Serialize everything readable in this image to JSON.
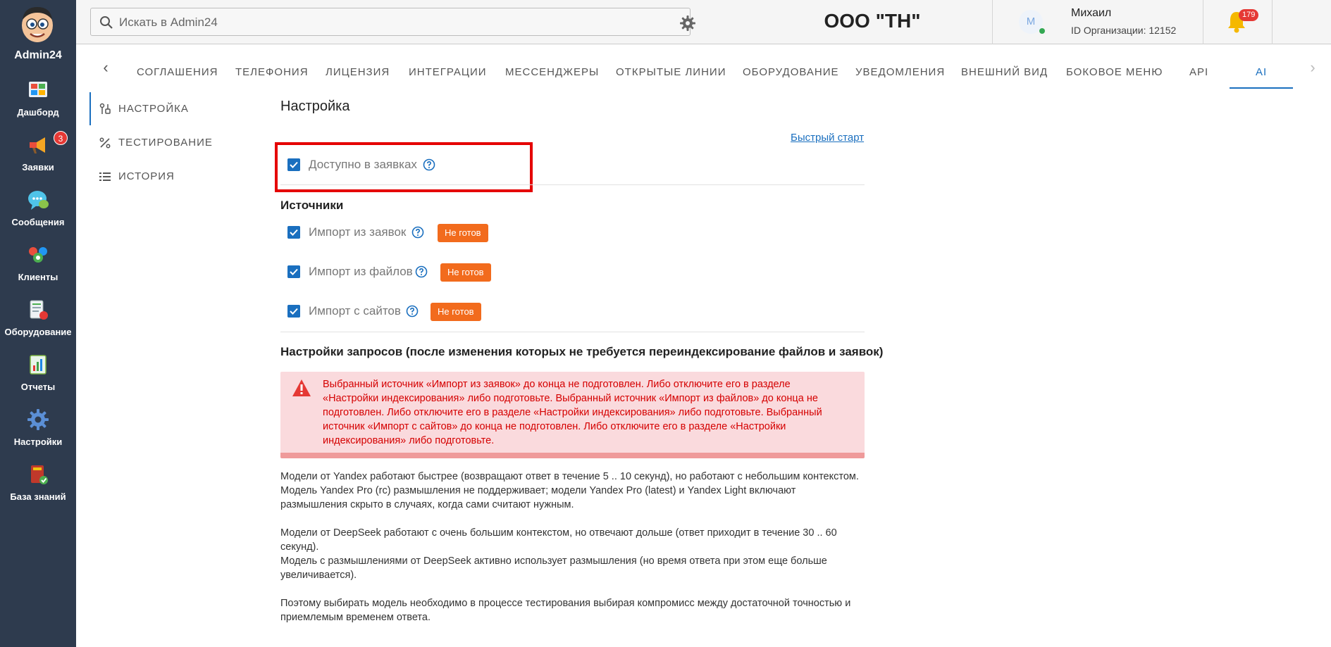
{
  "sidebar": {
    "brand": "Admin24",
    "items": [
      {
        "label": "Дашборд",
        "icon": "dashboard-icon"
      },
      {
        "label": "Заявки",
        "icon": "megaphone-icon",
        "badge": "3"
      },
      {
        "label": "Сообщения",
        "icon": "chat-icon"
      },
      {
        "label": "Клиенты",
        "icon": "clients-icon"
      },
      {
        "label": "Оборудование",
        "icon": "equipment-icon"
      },
      {
        "label": "Отчеты",
        "icon": "reports-icon"
      },
      {
        "label": "Настройки",
        "icon": "gear-icon"
      },
      {
        "label": "База знаний",
        "icon": "book-icon"
      }
    ]
  },
  "topbar": {
    "search_placeholder": "Искать в Admin24",
    "org_title": "ООО \"ТН\"",
    "user_initial": "М",
    "user_name": "Михаил",
    "org_id": "ID Организации: 12152",
    "notifications": "179",
    "help": "?"
  },
  "tabs": {
    "items": [
      "СОГЛАШЕНИЯ",
      "ТЕЛЕФОНИЯ",
      "ЛИЦЕНЗИЯ",
      "ИНТЕГРАЦИИ",
      "МЕССЕНДЖЕРЫ",
      "ОТКРЫТЫЕ ЛИНИИ",
      "ОБОРУДОВАНИЕ",
      "УВЕДОМЛЕНИЯ",
      "ВНЕШНИЙ ВИД",
      "БОКОВОЕ МЕНЮ",
      "API",
      "AI"
    ],
    "active": "AI",
    "prev": "‹",
    "next": "›"
  },
  "submenu": {
    "items": [
      "НАСТРОЙКА",
      "ТЕСТИРОВАНИЕ",
      "ИСТОРИЯ"
    ],
    "active": "НАСТРОЙКА"
  },
  "main": {
    "title": "Настройка",
    "quick_start": "Быстрый старт",
    "available_label": "Доступно в заявках",
    "available_checked": true,
    "sources_title": "Источники",
    "sources": [
      {
        "label": "Импорт из заявок",
        "status": "Не готов",
        "checked": true
      },
      {
        "label": "Импорт из файлов",
        "status": "Не готов",
        "checked": true
      },
      {
        "label": "Импорт с сайтов",
        "status": "Не готов",
        "checked": true
      }
    ],
    "requests_title": "Настройки запросов (после изменения которых не требуется переиндексирование файлов и заявок)",
    "alert": "Выбранный источник «Импорт из заявок» до конца не подготовлен. Либо отключите его в разделе «Настройки индексирования» либо подготовьте. Выбранный источник «Импорт из файлов» до конца не подготовлен. Либо отключите его в разделе «Настройки индексирования» либо подготовьте. Выбранный источник «Импорт с сайтов» до конца не подготовлен. Либо отключите его в разделе «Настройки индексирования» либо подготовьте.",
    "info": {
      "p1": "Модели от Yandex работают быстрее (возвращают ответ в течение 5 .. 10 секунд), но работают с небольшим контекстом.",
      "p2": "Модель Yandex Pro (rc) размышления не поддерживает; модели Yandex Pro (latest) и Yandex Light включают размышления скрыто в случаях, когда сами считают нужным.",
      "p3": "Модели от DeepSeek работают с очень большим контекстом, но отвечают дольше (ответ приходит в течение 30 .. 60 секунд).",
      "p4": "Модель с размышлениями от DeepSeek активно использует размышления (но время ответа при этом еще больше увеличивается).",
      "p5": "Поэтому выбирать модель необходимо в процессе тестирования выбирая компромисс между достаточной точностью и приемлемым временем ответа."
    }
  },
  "colors": {
    "sidebar": "#2e3b4e",
    "accent": "#1a6fbf",
    "badge_orange": "#f26b1d",
    "alert_text": "#d50000",
    "alert_bg": "#fadadd",
    "highlight": "#e50000"
  }
}
